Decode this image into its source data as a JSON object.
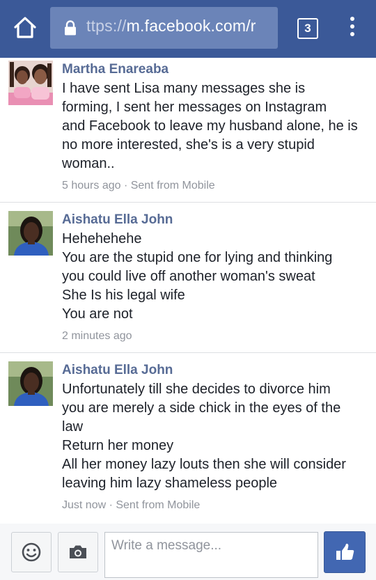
{
  "browser": {
    "url_prefix": "ttps://",
    "url_host": "m.facebook.com/r",
    "tab_count": "3",
    "icons": {
      "home": "home-icon",
      "lock": "lock-icon",
      "menu": "more-vert-icon"
    }
  },
  "messages": [
    {
      "author": "Martha Enareaba",
      "lines": [
        "I have sent Lisa many messages she is",
        "forming, I sent her messages on Instagram",
        "and Facebook to leave my husband alone, he is",
        "no more interested, she's is a very stupid",
        "woman.."
      ],
      "meta": "5 hours ago · Sent from Mobile"
    },
    {
      "author": "Aishatu Ella John",
      "lines": [
        "Hehehehehe",
        "You are the stupid one for lying and thinking",
        "you could live off another woman's sweat",
        "She Is his legal wife",
        "You are not"
      ],
      "meta": "2 minutes ago"
    },
    {
      "author": "Aishatu Ella John",
      "lines": [
        "Unfortunately till she decides to divorce him",
        "you are merely a side chick in the eyes of the",
        "law",
        "Return her money",
        "All her money lazy louts then she will consider",
        "leaving him lazy shameless people"
      ],
      "meta": "Just now · Sent from Mobile"
    }
  ],
  "composer": {
    "placeholder": "Write a message...",
    "icons": {
      "emoji": "smiley-icon",
      "camera": "camera-icon",
      "like": "thumbs-up-icon"
    }
  },
  "colors": {
    "brand": "#3b5998",
    "author": "#576b95",
    "like_button": "#4267b2"
  }
}
